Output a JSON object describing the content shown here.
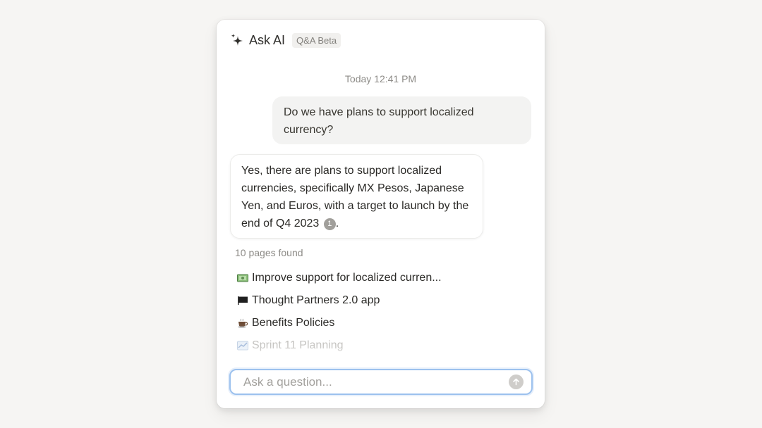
{
  "header": {
    "title": "Ask AI",
    "badge": "Q&A Beta"
  },
  "chat": {
    "timestamp": "Today 12:41 PM",
    "user_message": "Do we have plans to support localized currency?",
    "ai_message": "Yes, there are plans to support localized currencies, specifically MX Pesos, Japanese Yen, and Euros, with a target to launch by the end of Q4 2023",
    "ai_message_end": ".",
    "citation": "1"
  },
  "sources": {
    "count_label": "10 pages found",
    "pages": [
      {
        "icon": "banknote-icon",
        "title": "Improve support for localized curren..."
      },
      {
        "icon": "flag-icon",
        "title": "Thought Partners 2.0 app"
      },
      {
        "icon": "coffee-icon",
        "title": "Benefits Policies"
      },
      {
        "icon": "sprint-icon",
        "title": "Sprint 11 Planning"
      }
    ]
  },
  "input": {
    "placeholder": "Ask a question..."
  },
  "colors": {
    "accent_focus": "#9cc1ee",
    "send_disabled": "#cfcdca"
  }
}
